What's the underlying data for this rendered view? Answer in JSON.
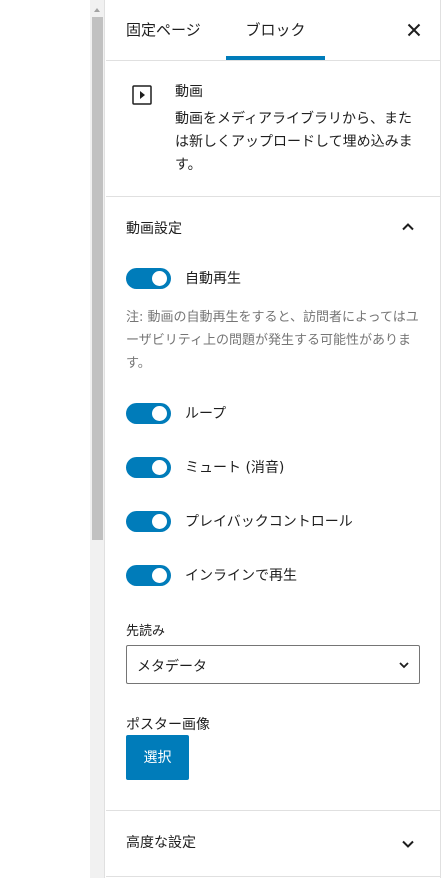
{
  "tabs": {
    "page": "固定ページ",
    "block": "ブロック"
  },
  "block": {
    "title": "動画",
    "description": "動画をメディアライブラリから、または新しくアップロードして埋め込みます。"
  },
  "video_settings": {
    "title": "動画設定",
    "autoplay_label": "自動再生",
    "autoplay_help": "注: 動画の自動再生をすると、訪問者によってはユーザビリティ上の問題が発生する可能性があります。",
    "loop_label": "ループ",
    "mute_label": "ミュート (消音)",
    "controls_label": "プレイバックコントロール",
    "inline_label": "インラインで再生",
    "preload_label": "先読み",
    "preload_value": "メタデータ",
    "poster_label": "ポスター画像",
    "poster_button": "選択"
  },
  "toggles": {
    "autoplay": true,
    "loop": true,
    "mute": true,
    "controls": true,
    "inline": true
  },
  "advanced": {
    "title": "高度な設定"
  },
  "colors": {
    "accent": "#007cba",
    "border": "#e0e0e0",
    "help": "#757575"
  }
}
